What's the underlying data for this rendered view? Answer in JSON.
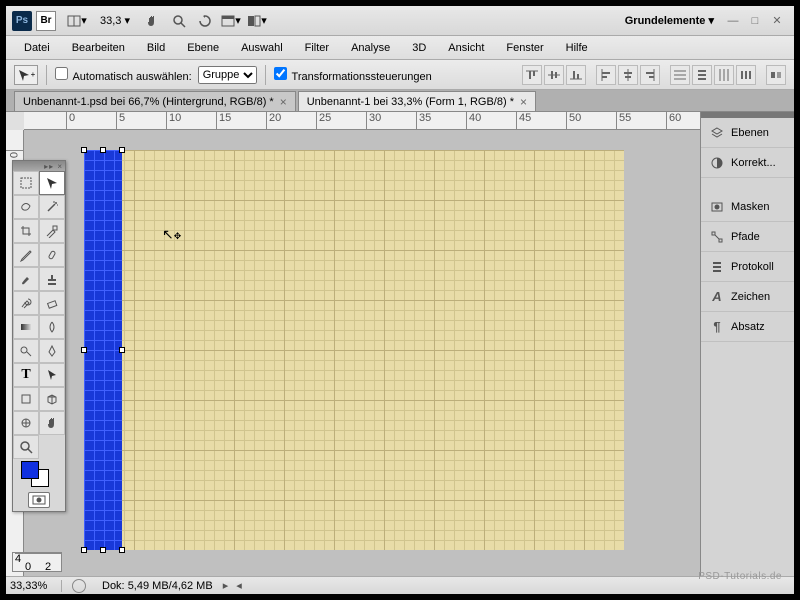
{
  "titlebar": {
    "zoom_value": "33,3",
    "workspace_label": "Grundelemente ▾"
  },
  "menu": {
    "items": [
      "Datei",
      "Bearbeiten",
      "Bild",
      "Ebene",
      "Auswahl",
      "Filter",
      "Analyse",
      "3D",
      "Ansicht",
      "Fenster",
      "Hilfe"
    ]
  },
  "optbar": {
    "auto_select_label": "Automatisch auswählen:",
    "auto_select_checked": false,
    "group_dropdown": "Gruppe",
    "transform_label": "Transformationssteuerungen",
    "transform_checked": true
  },
  "tabs": [
    {
      "label": "Unbenannt-1.psd bei 66,7% (Hintergrund, RGB/8) *",
      "active": false
    },
    {
      "label": "Unbenannt-1 bei 33,3% (Form 1, RGB/8) *",
      "active": true
    }
  ],
  "ruler_h": [
    "",
    "0",
    "5",
    "10",
    "15",
    "20",
    "25",
    "30",
    "35",
    "40",
    "45",
    "50",
    "55",
    "60"
  ],
  "ruler_v_top": "0",
  "panels": {
    "items": [
      {
        "icon": "layers",
        "label": "Ebenen"
      },
      {
        "icon": "adjust",
        "label": "Korrekt..."
      }
    ],
    "items2": [
      {
        "icon": "mask",
        "label": "Masken"
      },
      {
        "icon": "paths",
        "label": "Pfade"
      },
      {
        "icon": "history",
        "label": "Protokoll"
      },
      {
        "icon": "character",
        "label": "Zeichen"
      },
      {
        "icon": "paragraph",
        "label": "Absatz"
      }
    ]
  },
  "statusbar": {
    "zoom": "33,33%",
    "doc_label": "Dok:",
    "doc_value": "5,49 MB/4,62 MB"
  },
  "mini_ruler_vals": [
    "4",
    "0",
    "2"
  ],
  "watermark": "PSD-Tutorials.de"
}
